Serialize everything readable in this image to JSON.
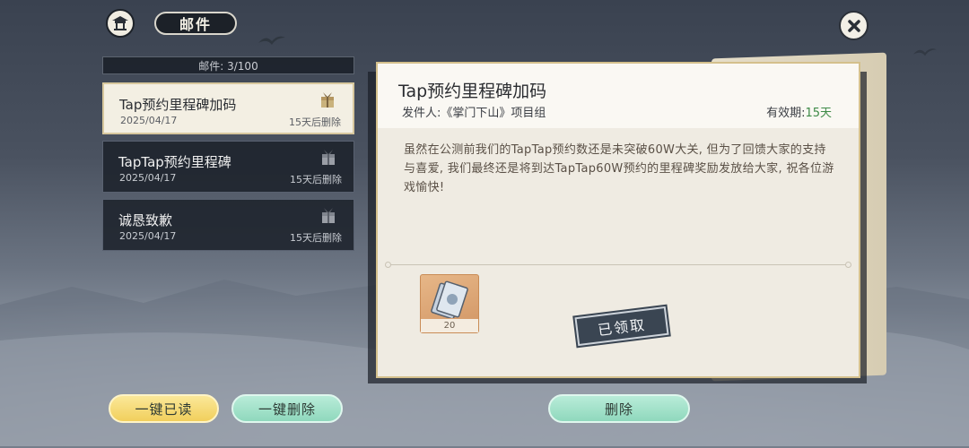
{
  "header": {
    "title": "邮件",
    "home_icon": "pavilion-icon",
    "close_icon": "close-icon"
  },
  "mail_count": "邮件: 3/100",
  "mails": [
    {
      "title": "Tap预约里程碑加码",
      "date": "2025/04/17",
      "expire": "15天后删除",
      "active": true
    },
    {
      "title": "TapTap预约里程碑",
      "date": "2025/04/17",
      "expire": "15天后删除",
      "active": false
    },
    {
      "title": "诚恳致歉",
      "date": "2025/04/17",
      "expire": "15天后删除",
      "active": false
    }
  ],
  "detail": {
    "title": "Tap预约里程碑加码",
    "sender": "发件人:《掌门下山》项目组",
    "validity_label": "有效期:",
    "validity_value": "15天",
    "body": "虽然在公测前我们的TapTap预约数还是未突破60W大关, 但为了回馈大家的支持与喜爱, 我们最终还是将到达TapTap60W预约的里程碑奖励发放给大家, 祝各位游戏愉快!",
    "reward_icon": "banknote-icon",
    "reward_qty": "20",
    "claimed_label": "已领取"
  },
  "buttons": {
    "read_all": "一键已读",
    "delete_all": "一键删除",
    "delete": "删除"
  },
  "colors": {
    "validity_green": "#3e8a47",
    "read_button": "#f1cf5c",
    "delete_button": "#8fd8bd"
  }
}
